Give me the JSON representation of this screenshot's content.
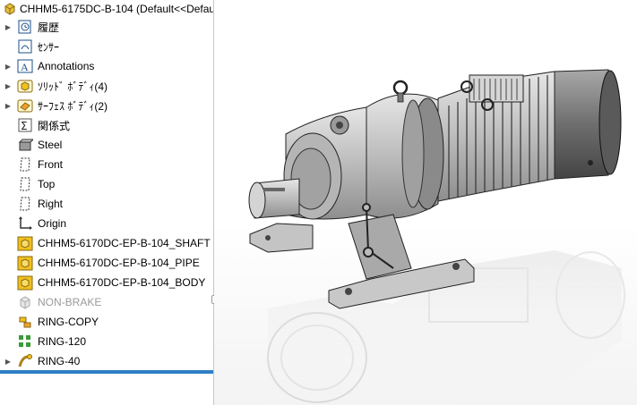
{
  "tree": {
    "title": "CHHM5-6175DC-B-104  (Default<<Defau",
    "items": [
      {
        "label": "履歴",
        "icon": "history-icon",
        "expandable": true
      },
      {
        "label": "ｾﾝｻｰ",
        "icon": "sensor-icon",
        "expandable": false
      },
      {
        "label": "Annotations",
        "icon": "annotations-icon",
        "expandable": true
      },
      {
        "label": "ｿﾘｯﾄﾞ ﾎﾞﾃﾞｨ(4)",
        "icon": "solid-bodies-icon",
        "expandable": true
      },
      {
        "label": "ｻｰﾌｪｽ ﾎﾞﾃﾞｨ(2)",
        "icon": "surface-bodies-icon",
        "expandable": true
      },
      {
        "label": "関係式",
        "icon": "equations-icon",
        "expandable": false
      },
      {
        "label": "Steel",
        "icon": "material-icon",
        "expandable": false
      },
      {
        "label": "Front",
        "icon": "plane-icon",
        "expandable": false
      },
      {
        "label": "Top",
        "icon": "plane-icon",
        "expandable": false
      },
      {
        "label": "Right",
        "icon": "plane-icon",
        "expandable": false
      },
      {
        "label": "Origin",
        "icon": "origin-icon",
        "expandable": false
      },
      {
        "label": "CHHM5-6170DC-EP-B-104_SHAFT",
        "icon": "imported-part-icon",
        "expandable": false
      },
      {
        "label": "CHHM5-6170DC-EP-B-104_PIPE",
        "icon": "imported-part-icon",
        "expandable": false
      },
      {
        "label": "CHHM5-6170DC-EP-B-104_BODY",
        "icon": "imported-part-icon",
        "expandable": false
      },
      {
        "label": "NON-BRAKE",
        "icon": "suppressed-feature-icon",
        "expandable": false,
        "dim": true
      },
      {
        "label": "RING-COPY",
        "icon": "move-copy-icon",
        "expandable": false
      },
      {
        "label": "RING-120",
        "icon": "pattern-icon",
        "expandable": false
      },
      {
        "label": "RING-40",
        "icon": "sweep-icon",
        "expandable": true
      }
    ]
  },
  "colors": {
    "accent_bar": "#2f7fc4",
    "imported_part": "#f0c020",
    "model_metal": "#bdbdbd"
  }
}
